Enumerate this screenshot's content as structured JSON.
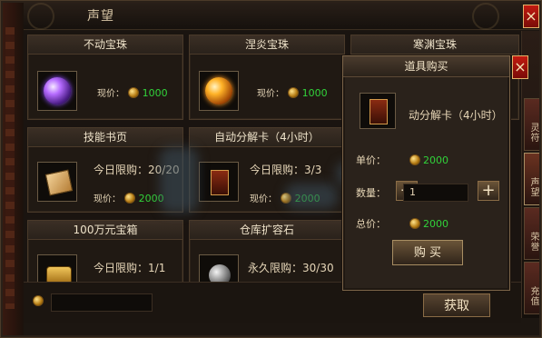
{
  "window": {
    "title": "声望",
    "obtain_button": "获取"
  },
  "cards": [
    {
      "title": "不动宝珠",
      "price_label": "现价：",
      "price": "1000"
    },
    {
      "title": "涅炎宝珠",
      "price_label": "现价：",
      "price": "1000"
    },
    {
      "title": "寒渊宝珠"
    },
    {
      "title": "技能书页",
      "limit_label": "今日限购：",
      "limit_value": "20/20",
      "price_label": "现价：",
      "price": "2000"
    },
    {
      "title": "自动分解卡（4小时）",
      "limit_label": "今日限购：",
      "limit_value": "3/3",
      "price_label": "现价：",
      "price": "2000"
    },
    {
      "title": "100万元宝箱",
      "limit_label": "今日限购：",
      "limit_value": "1/1"
    },
    {
      "title": "仓库扩容石",
      "limit_label": "永久限购：",
      "limit_value": "30/30"
    }
  ],
  "popup": {
    "title": "道具购买",
    "item_name": "动分解卡（4小时）",
    "unit_price_label": "单价：",
    "unit_price": "2000",
    "qty_label": "数量：",
    "qty_value": "1",
    "total_label": "总价：",
    "total_price": "2000",
    "buy_button": "购 买"
  },
  "right_tabs": [
    {
      "label": "灵符"
    },
    {
      "label": "声望"
    },
    {
      "label": "荣誉"
    },
    {
      "label": "充值"
    }
  ],
  "colors": {
    "price_green": "#31d23a",
    "close_red": "#c11a10",
    "frame_gold": "#a88e63"
  },
  "icons": {
    "close": "close-icon",
    "coin": "gold-coin-icon",
    "minus": "minus-icon",
    "plus": "plus-icon"
  }
}
